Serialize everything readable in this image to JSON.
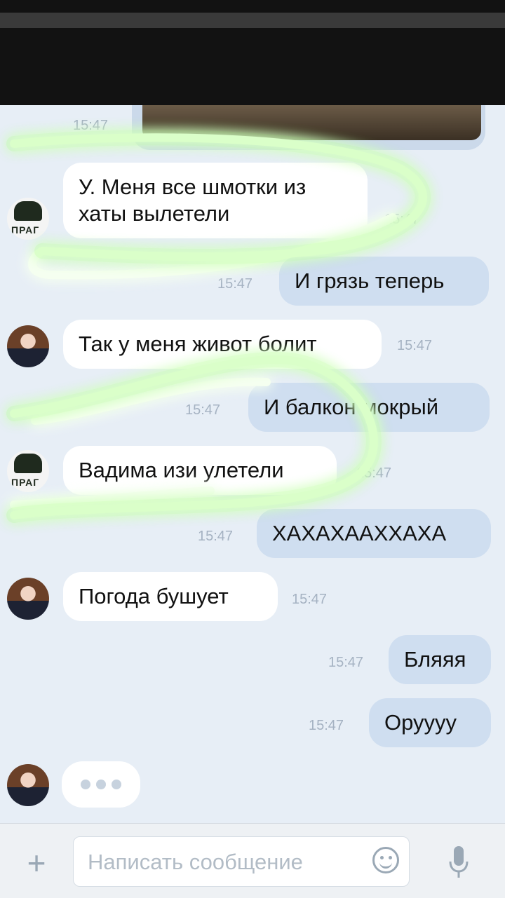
{
  "header": {
    "status_redacted": true
  },
  "messages": [
    {
      "id": "m0",
      "direction": "out",
      "kind": "image",
      "time": "15:47"
    },
    {
      "id": "m1",
      "direction": "in",
      "avatar": "group-logo-avatar",
      "text": "У. Меня все шмотки из\nхаты вылетели",
      "time": "15:47"
    },
    {
      "id": "m2",
      "direction": "out",
      "text": "И грязь теперь",
      "time": "15:47"
    },
    {
      "id": "m3",
      "direction": "in",
      "avatar": "girl-avatar",
      "text": "Так у меня живот болит",
      "time": "15:47"
    },
    {
      "id": "m4",
      "direction": "out",
      "text": "И балкон мокрый",
      "time": "15:47"
    },
    {
      "id": "m5",
      "direction": "in",
      "avatar": "group-logo-avatar",
      "text": "Вадима изи улетели",
      "time": "15:47"
    },
    {
      "id": "m6",
      "direction": "out",
      "text": "ХАХАХААХХАХА",
      "time": "15:47"
    },
    {
      "id": "m7",
      "direction": "in",
      "avatar": "girl-avatar",
      "text": "Погода бушует",
      "time": "15:47"
    },
    {
      "id": "m8",
      "direction": "out",
      "text": "Бляяя",
      "time": "15:47"
    },
    {
      "id": "m9",
      "direction": "out",
      "text": "Оруууу",
      "time": "15:47"
    }
  ],
  "typing_indicator": {
    "avatar": "girl-avatar"
  },
  "composer": {
    "placeholder": "Написать сообщение",
    "attach_icon": "plus-icon",
    "emoji_icon": "emoji-icon",
    "mic_icon": "microphone-icon"
  },
  "annotations": {
    "highlight_color": "#8cff5a"
  },
  "colors": {
    "background": "#e7eef6",
    "incoming_bubble": "#ffffff",
    "outgoing_bubble": "#cfdef0"
  }
}
